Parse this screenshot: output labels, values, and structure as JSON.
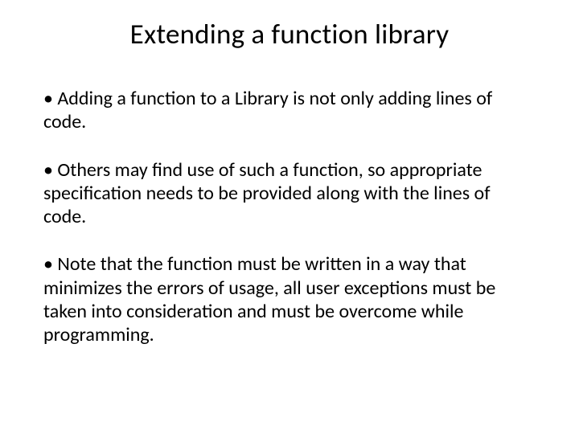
{
  "slide": {
    "title": "Extending a function library",
    "bullets": [
      "Adding a function to a Library is not only adding lines of code.",
      "Others may find use of such a function, so appropriate specification needs to be provided along with the lines of code.",
      "Note that the function must be written in a way that minimizes the errors of usage, all user exceptions must be taken into consideration and must be overcome while programming."
    ],
    "bullet_glyph": "•"
  }
}
